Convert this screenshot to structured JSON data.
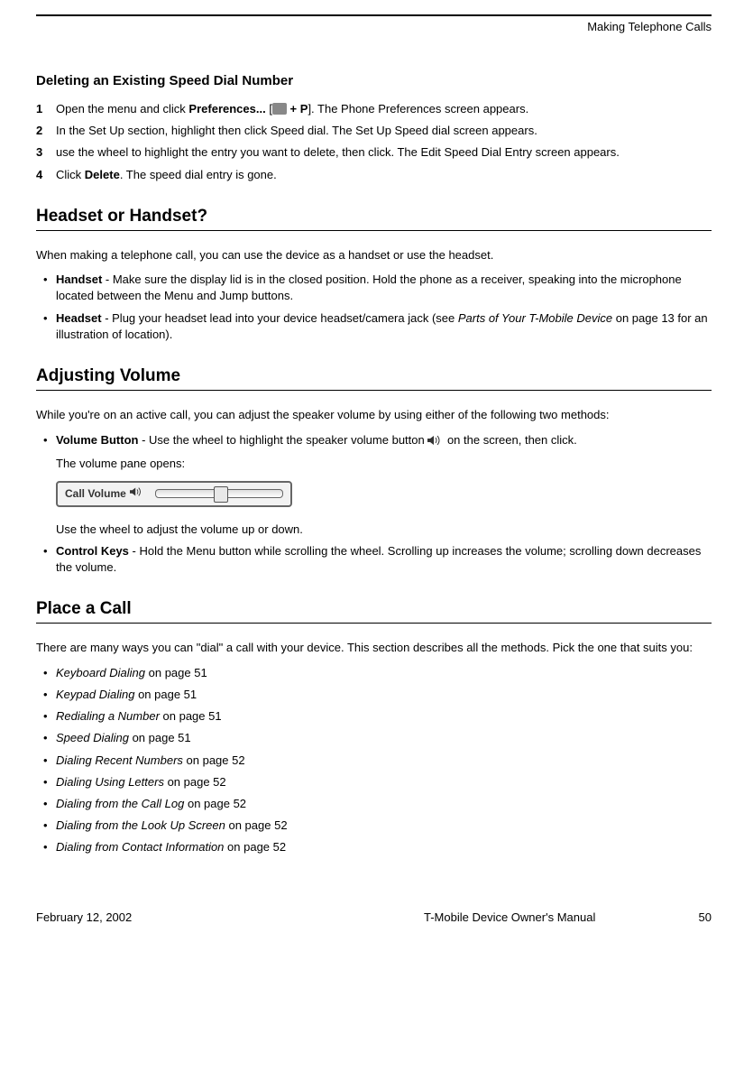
{
  "header": {
    "chapter": "Making Telephone Calls"
  },
  "sect_del": {
    "title": "Deleting an Existing Speed Dial Number",
    "steps": [
      {
        "n": "1",
        "pre": "Open the menu and click ",
        "bold": "Preferences...",
        "mid": " [",
        "after_icon": " + P",
        "close": "]. The Phone Preferences screen appears."
      },
      {
        "n": "2",
        "text": "In the Set Up section, highlight then click Speed dial. The Set Up Speed dial screen appears."
      },
      {
        "n": "3",
        "text": "use the wheel to highlight the entry you want to delete, then click. The Edit Speed Dial Entry screen appears."
      },
      {
        "n": "4",
        "pre": "Click ",
        "bold": "Delete",
        "post": ". The speed dial entry is gone."
      }
    ]
  },
  "sect_hh": {
    "title": "Headset or Handset?",
    "intro": "When making a telephone call, you can use the device as a handset or use the headset.",
    "items": [
      {
        "bold": "Handset",
        "text": " - Make sure the display lid is in the closed position. Hold the phone as a receiver, speaking into the microphone located between the Menu and Jump buttons."
      },
      {
        "bold": "Headset",
        "pre": " - Plug your headset lead into your device headset/camera jack (see ",
        "italic": "Parts of Your T-Mobile Device",
        "post": " on page 13 for an illustration of location)."
      }
    ]
  },
  "sect_vol": {
    "title": "Adjusting Volume",
    "intro": "While you're on an active call, you can adjust the speaker volume by using either of the following two methods:",
    "item1_bold": "Volume Button",
    "item1_pre": " - Use the wheel to highlight the speaker volume button  ",
    "item1_post": "  on the screen, then click.",
    "item1_sub": "The volume pane opens:",
    "widget_label": "Call Volume",
    "item1_note": "Use the wheel to adjust the volume up or down.",
    "item2_bold": "Control Keys",
    "item2_text": " - Hold the Menu button while scrolling the wheel. Scrolling up increases the volume; scrolling down decreases the volume."
  },
  "sect_call": {
    "title": "Place a Call",
    "intro": "There are many ways you can \"dial\" a call with your device. This section describes all the methods. Pick the one that suits you:",
    "items": [
      {
        "italic": "Keyboard Dialing",
        "post": " on page 51"
      },
      {
        "italic": "Keypad Dialing",
        "post": " on page 51"
      },
      {
        "italic": "Redialing a Number",
        "post": " on page 51"
      },
      {
        "italic": "Speed Dialing",
        "post": " on page 51"
      },
      {
        "italic": "Dialing Recent Numbers",
        "post": " on page 52"
      },
      {
        "italic": "Dialing Using Letters",
        "post": " on page 52"
      },
      {
        "italic": "Dialing from the Call Log",
        "post": " on page 52"
      },
      {
        "italic": "Dialing from the Look Up Screen",
        "post": " on page 52"
      },
      {
        "italic": "Dialing from Contact Information",
        "post": " on page 52"
      }
    ]
  },
  "footer": {
    "date": "February 12, 2002",
    "manual": "T-Mobile Device Owner's Manual",
    "page": "50"
  }
}
